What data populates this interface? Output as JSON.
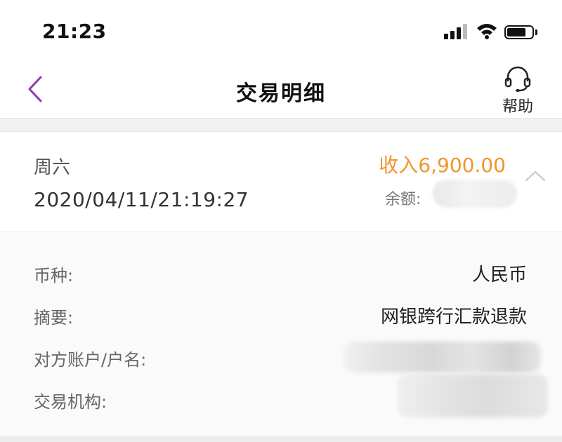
{
  "status_bar": {
    "time": "21:23",
    "icons": [
      "signal-icon",
      "wifi-icon",
      "battery-icon"
    ]
  },
  "nav": {
    "back_icon": "chevron-left-icon",
    "title": "交易明细",
    "help_icon": "headset-icon",
    "help_label": "帮助"
  },
  "transaction": {
    "weekday": "周六",
    "datetime": "2020/04/11/21:19:27",
    "amount": "收入6,900.00",
    "balance_label": "余额:",
    "collapse_icon": "chevron-up-icon"
  },
  "details": [
    {
      "label": "币种:",
      "value": "人民币"
    },
    {
      "label": "摘要:",
      "value": "网银跨行汇款退款"
    },
    {
      "label": "对方账户/户名:",
      "value": ""
    },
    {
      "label": "交易机构:",
      "value": ""
    }
  ],
  "colors": {
    "accent_purple": "#8a3ab9",
    "income_orange": "#f0952e",
    "text_dark": "#222222",
    "text_muted": "#666666"
  }
}
